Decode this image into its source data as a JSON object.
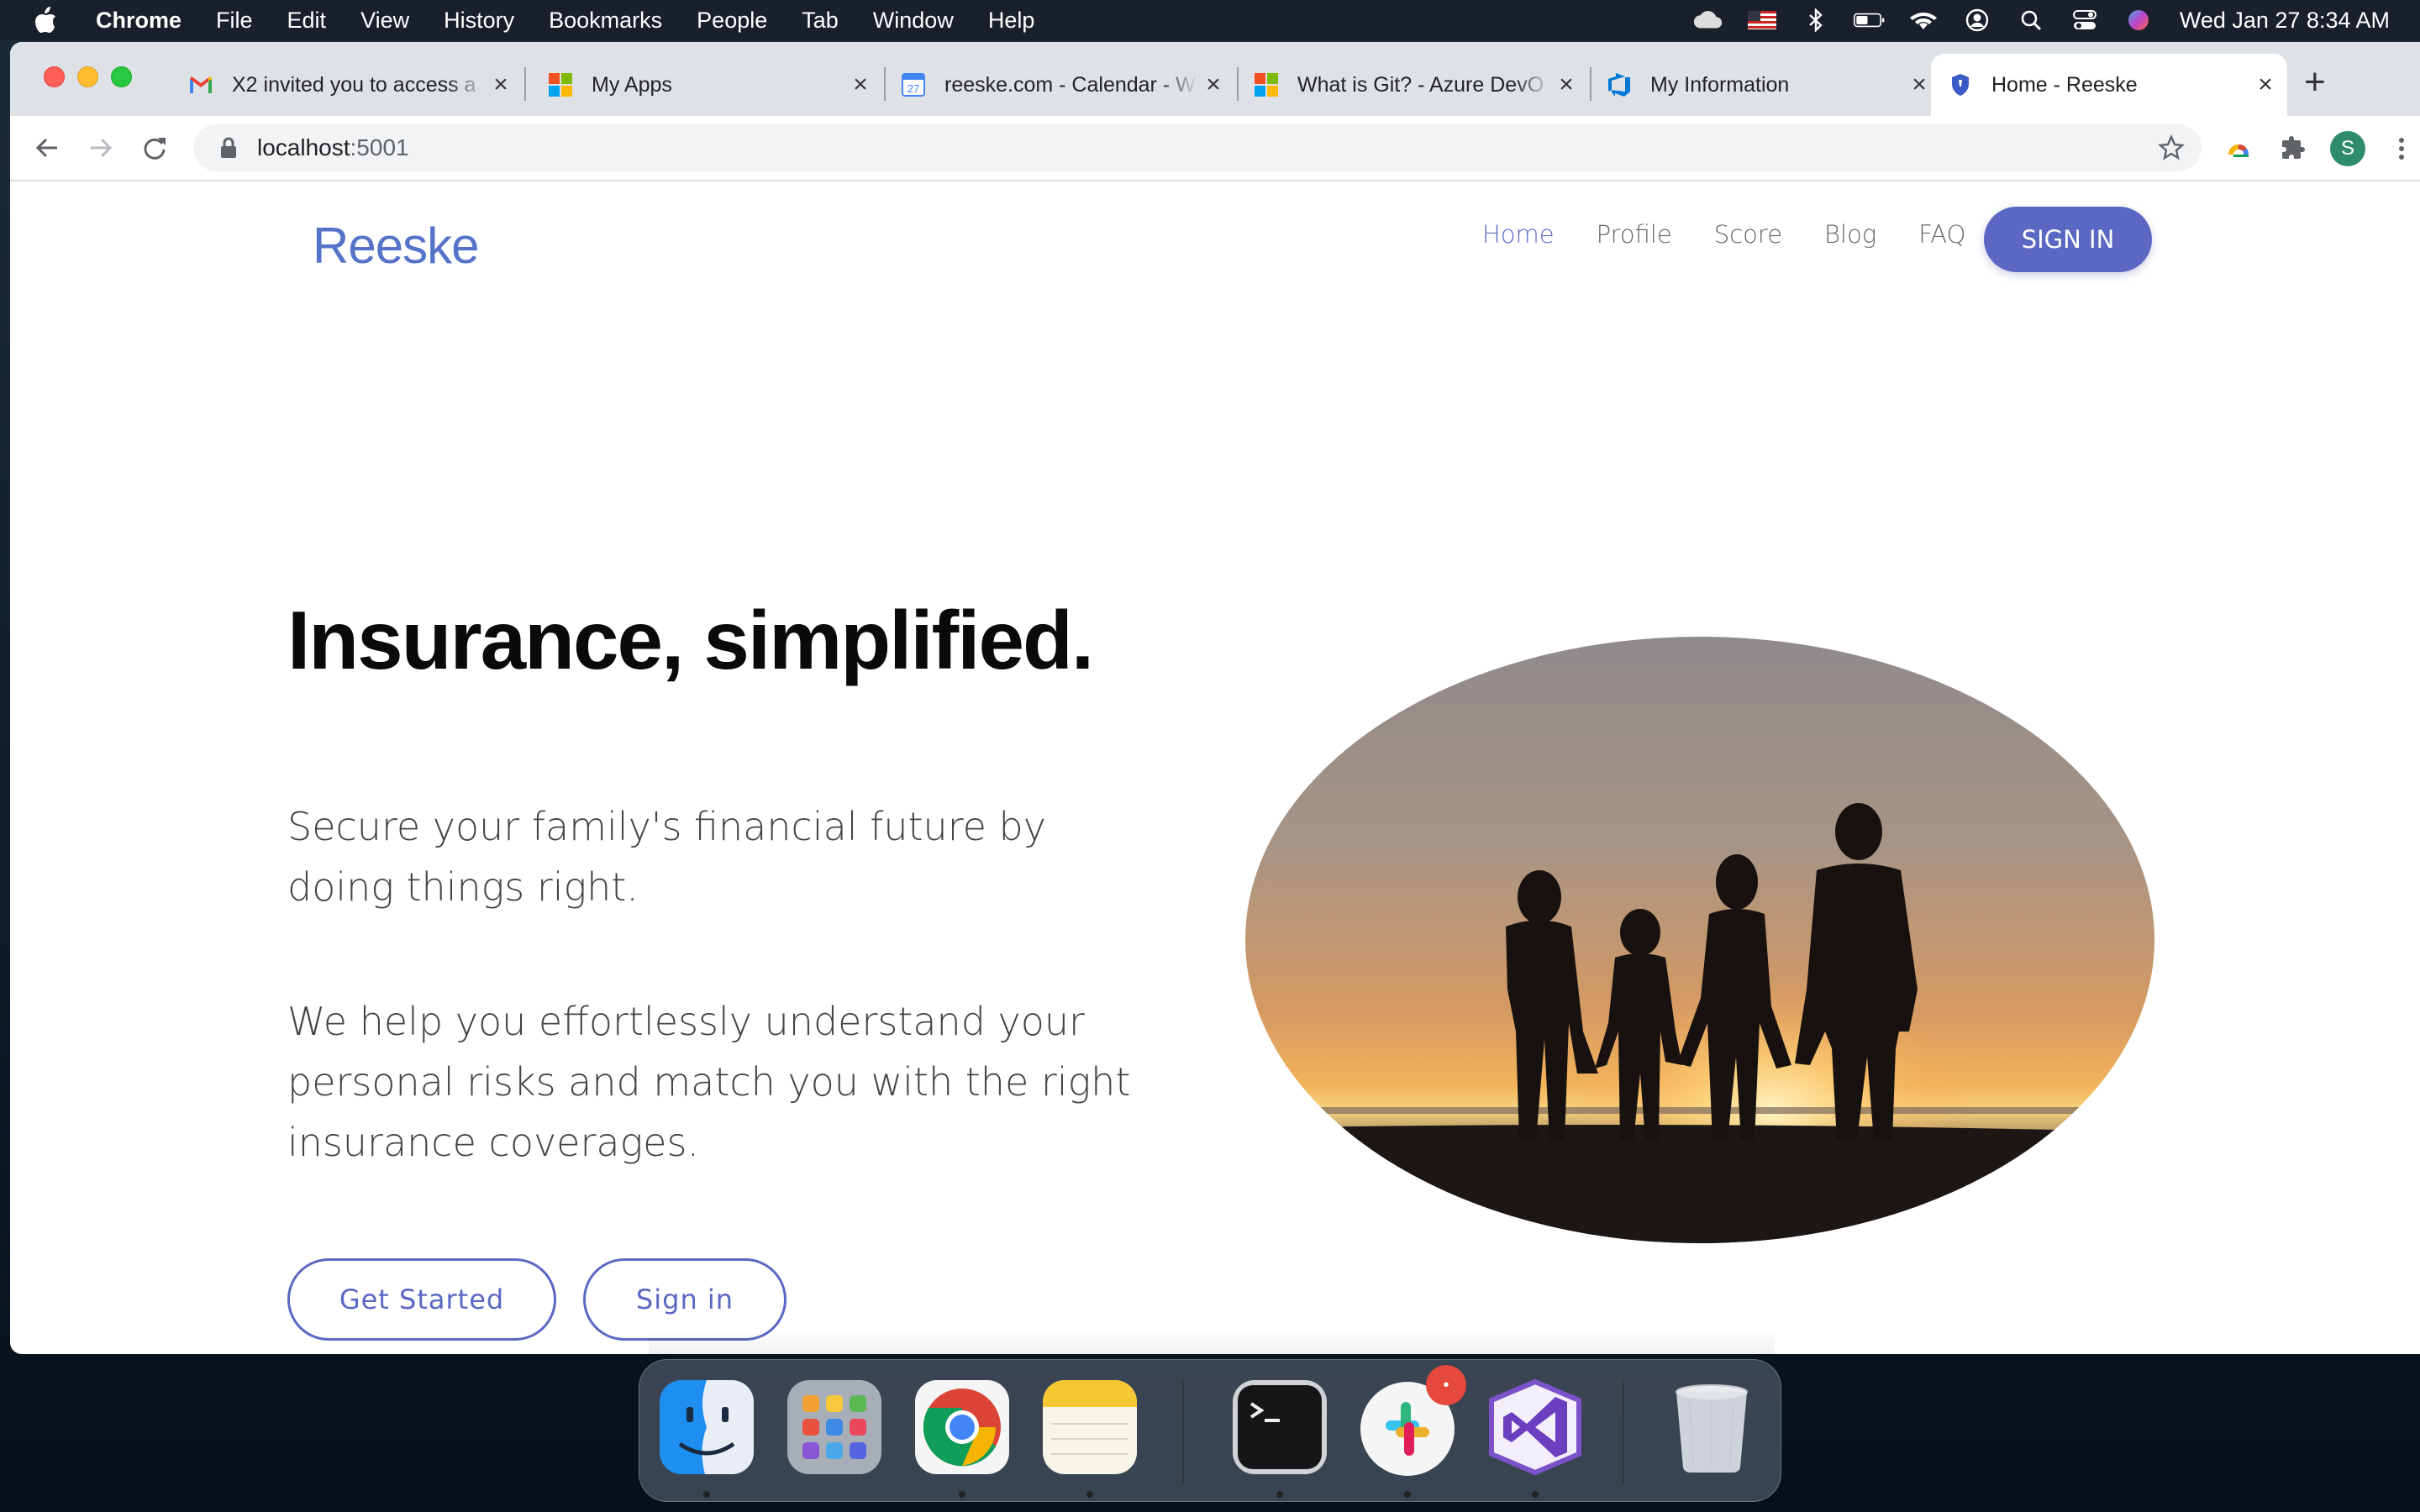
{
  "menubar": {
    "app_name": "Chrome",
    "items": [
      "File",
      "Edit",
      "View",
      "History",
      "Bookmarks",
      "People",
      "Tab",
      "Window",
      "Help"
    ],
    "clock": "Wed Jan 27  8:34 AM"
  },
  "tabs": [
    {
      "title": "X2 invited you to access a",
      "favicon": "gmail-icon"
    },
    {
      "title": "My Apps",
      "favicon": "microsoft-icon"
    },
    {
      "title": "reeske.com - Calendar - W",
      "favicon": "calendar-icon"
    },
    {
      "title": "What is Git? - Azure DevO",
      "favicon": "microsoft-icon"
    },
    {
      "title": "My Information",
      "favicon": "azure-devops-icon"
    },
    {
      "title": "Home - Reeske",
      "favicon": "shield-icon",
      "active": true
    }
  ],
  "address_bar": {
    "host": "localhost",
    "port": ":5001"
  },
  "profile_initial": "S",
  "site": {
    "logo": "Reeske",
    "nav": [
      "Home",
      "Profile",
      "Score",
      "Blog",
      "FAQ"
    ],
    "active_nav": "Home",
    "signin_button": "SIGN IN",
    "hero": {
      "title": "Insurance, simplified.",
      "paragraph1": "Secure your family's financial future by doing things right.",
      "paragraph2": "We help you effortlessly understand your personal risks and match you with the right insurance coverages.",
      "get_started": "Get Started",
      "sign_in": "Sign in"
    },
    "accent_color": "#5b68c3"
  },
  "dock": {
    "apps": [
      "finder-icon",
      "launchpad-icon",
      "chrome-icon",
      "notes-icon",
      "terminal-icon",
      "slack-icon",
      "visual-studio-icon",
      "trash-icon"
    ],
    "slack_badge": "•"
  }
}
